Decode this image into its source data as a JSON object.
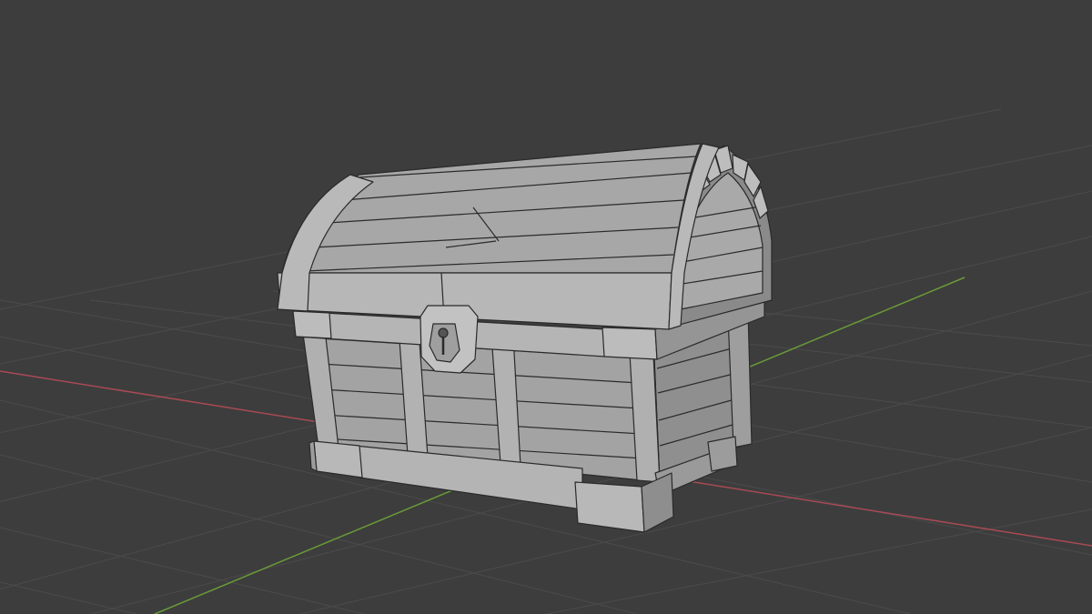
{
  "viewport": {
    "background": "#3d3d3d",
    "grid_color": "#4d4d4d",
    "axis_x_color": "#a84a55",
    "axis_y_color": "#6a9a38"
  },
  "model": {
    "object": "treasure-chest",
    "shading": "solid-gray",
    "face_color": "#a6a6a6",
    "face_light": "#b4b4b4",
    "face_dark": "#8c8c8c",
    "edge_color": "#2a2a2a"
  }
}
